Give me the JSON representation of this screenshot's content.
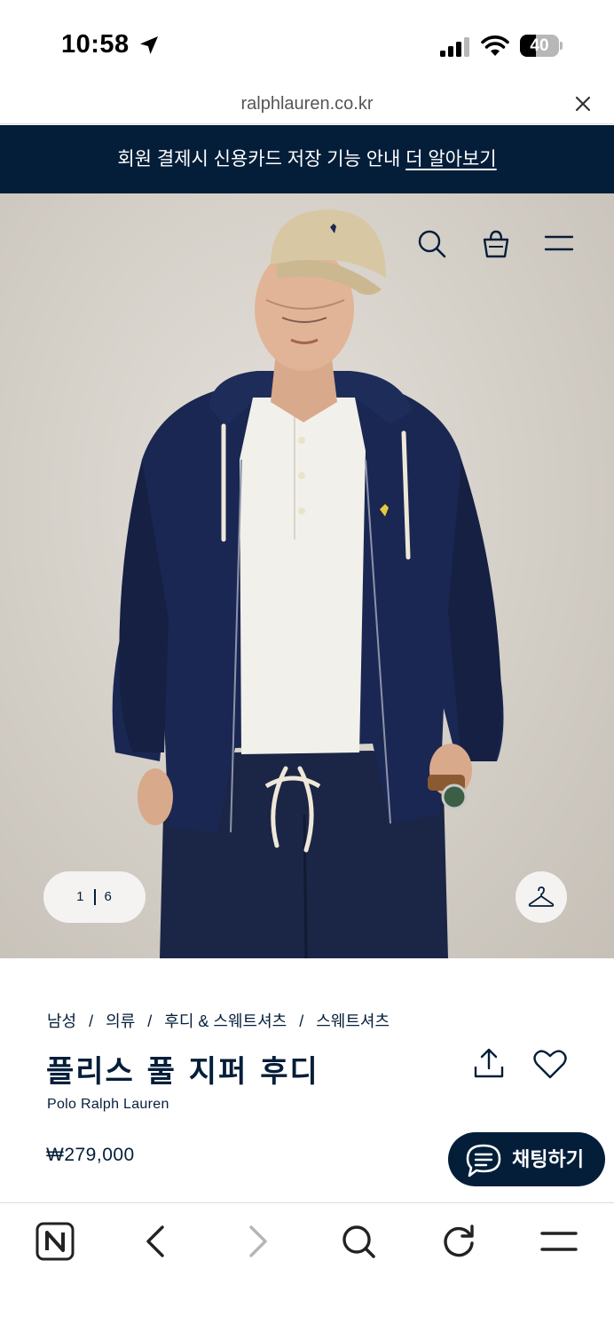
{
  "status_bar": {
    "time": "10:58",
    "battery": "40",
    "battery_level": 0.4
  },
  "browser": {
    "url": "ralphlauren.co.kr"
  },
  "banner": {
    "text": "회원 결제시 신용카드 저장 기능 안내",
    "link": "더 알아보기"
  },
  "gallery": {
    "current": "1",
    "total": "6"
  },
  "breadcrumb": [
    "남성",
    "의류",
    "후디 & 스웨트셔츠",
    "스웨트셔츠"
  ],
  "breadcrumb_separator": "/",
  "product": {
    "title": "플리스 풀 지퍼 후디",
    "brand": "Polo Ralph Lauren",
    "price": "₩279,000"
  },
  "chat": {
    "label": "채팅하기"
  },
  "colors": {
    "navy": "#041e3a",
    "banner_bg": "#041e3a",
    "disabled": "#b5b5b5"
  },
  "icons": {
    "status": [
      "location-arrow-icon",
      "signal-icon",
      "wifi-icon",
      "battery-icon"
    ],
    "header": [
      "search-icon",
      "shopping-bag-icon",
      "menu-icon"
    ],
    "product": [
      "share-icon",
      "heart-icon",
      "hanger-icon",
      "chat-icon"
    ],
    "toolbar": [
      "naver-home-icon",
      "back-icon",
      "forward-icon",
      "search-icon",
      "reload-icon",
      "menu-icon"
    ]
  }
}
